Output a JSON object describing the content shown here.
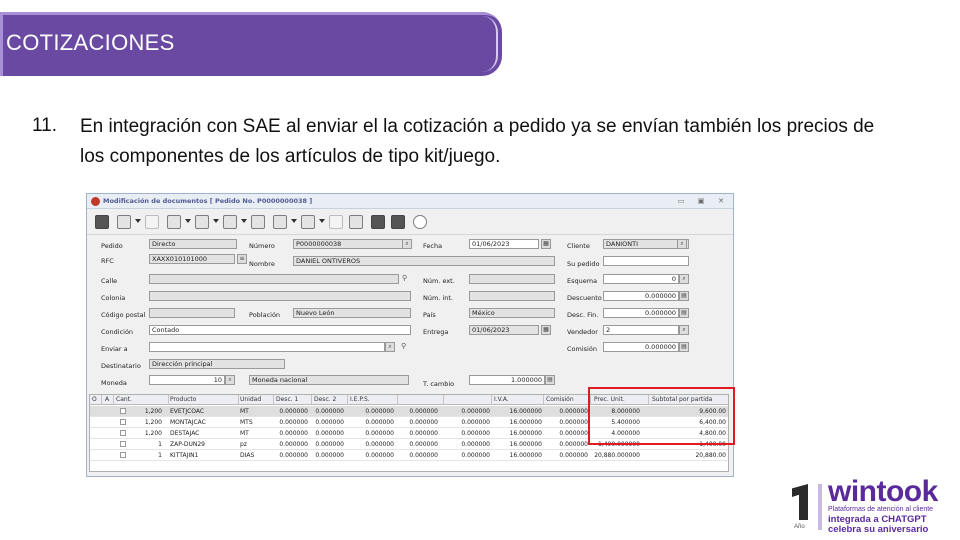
{
  "slide": {
    "title": "COTIZACIONES",
    "item_number": "11.",
    "paragraph": "En integración con SAE al enviar el la cotización a pedido ya se envían también los precios de los componentes de los artículos de tipo kit/juego."
  },
  "window": {
    "title": "Modificación de documentos [ Pedido No. P0000000038 ]",
    "min": "▭",
    "max": "▣",
    "close": "✕"
  },
  "form": {
    "pedido_label": "Pedido",
    "pedido_value": "Directo",
    "numero_label": "Número",
    "numero_value": "P0000000038",
    "fecha_label": "Fecha",
    "fecha_value": "01/06/2023",
    "cliente_label": "Cliente",
    "cliente_value": "DANIONTI",
    "rfc_label": "RFC",
    "rfc_value": "XAXX010101000",
    "nombre_label": "Nombre",
    "nombre_value": "DANIEL ONTIVEROS",
    "supedido_label": "Su pedido",
    "supedido_value": "",
    "calle_label": "Calle",
    "calle_value": "",
    "numext_label": "Núm. ext.",
    "numext_value": "",
    "esquema_label": "Esquema",
    "esquema_value": "0",
    "colonia_label": "Colonia",
    "colonia_value": "",
    "numint_label": "Núm. int.",
    "numint_value": "",
    "descuento_label": "Descuento",
    "descuento_value": "0.000000",
    "cp_label": "Código postal",
    "cp_value": "",
    "poblacion_label": "Población",
    "poblacion_value": "Nuevo León",
    "pais_label": "País",
    "pais_value": "México",
    "descfin_label": "Desc. Fin.",
    "descfin_value": "0.000000",
    "condicion_label": "Condición",
    "condicion_value": "Contado",
    "entrega_label": "Entrega",
    "entrega_value": "01/06/2023",
    "vendedor_label": "Vendedor",
    "vendedor_value": "2",
    "enviar_label": "Enviar a",
    "enviar_value": "",
    "comision_label": "Comisión",
    "comision_value": "0.000000",
    "destinatario_label": "Destinatario",
    "destinatario_value": "Dirección principal",
    "moneda_label": "Moneda",
    "moneda_value": "10",
    "moneda_name": "Moneda nacional",
    "tcambio_label": "T. cambio",
    "tcambio_value": "1.000000"
  },
  "grid": {
    "headers": [
      "O",
      "A",
      "Cant.",
      "Producto",
      "Unidad",
      "Desc. 1",
      "Desc. 2",
      "I.E.P.S.",
      "",
      "",
      "I.V.A.",
      "Comisión",
      "Prec. Unit.",
      "Subtotal por partida"
    ],
    "rows": [
      [
        "1,200",
        "EVETJCOAC",
        "MT",
        "0.000000",
        "0.000000",
        "0.000000",
        "0.000000",
        "0.000000",
        "16.000000",
        "0.000000",
        "8.000000",
        "9,600.00"
      ],
      [
        "1,200",
        "MONTAJCAC",
        "MTS",
        "0.000000",
        "0.000000",
        "0.000000",
        "0.000000",
        "0.000000",
        "16.000000",
        "0.000000",
        "5.400000",
        "6,400.00"
      ],
      [
        "1,200",
        "DESTAJAC",
        "MT",
        "0.000000",
        "0.000000",
        "0.000000",
        "0.000000",
        "0.000000",
        "16.000000",
        "0.000000",
        "4.000000",
        "4,800.00"
      ],
      [
        "1",
        "ZAP-DUN29",
        "pz",
        "0.000000",
        "0.000000",
        "0.000000",
        "0.000000",
        "0.000000",
        "16.000000",
        "0.000000",
        "1,400.000000",
        "1,400.00"
      ],
      [
        "1",
        "KITTAJIN1",
        "DIAS",
        "0.000000",
        "0.000000",
        "0.000000",
        "0.000000",
        "0.000000",
        "16.000000",
        "0.000000",
        "20,880.000000",
        "20,880.00"
      ]
    ]
  },
  "logo": {
    "number": "1",
    "year": "Año",
    "brand": "wintook",
    "tagline": "Plataformas de atención al cliente",
    "line2": "integrada a CHATGPT",
    "line3": "celebra su aniversario"
  }
}
